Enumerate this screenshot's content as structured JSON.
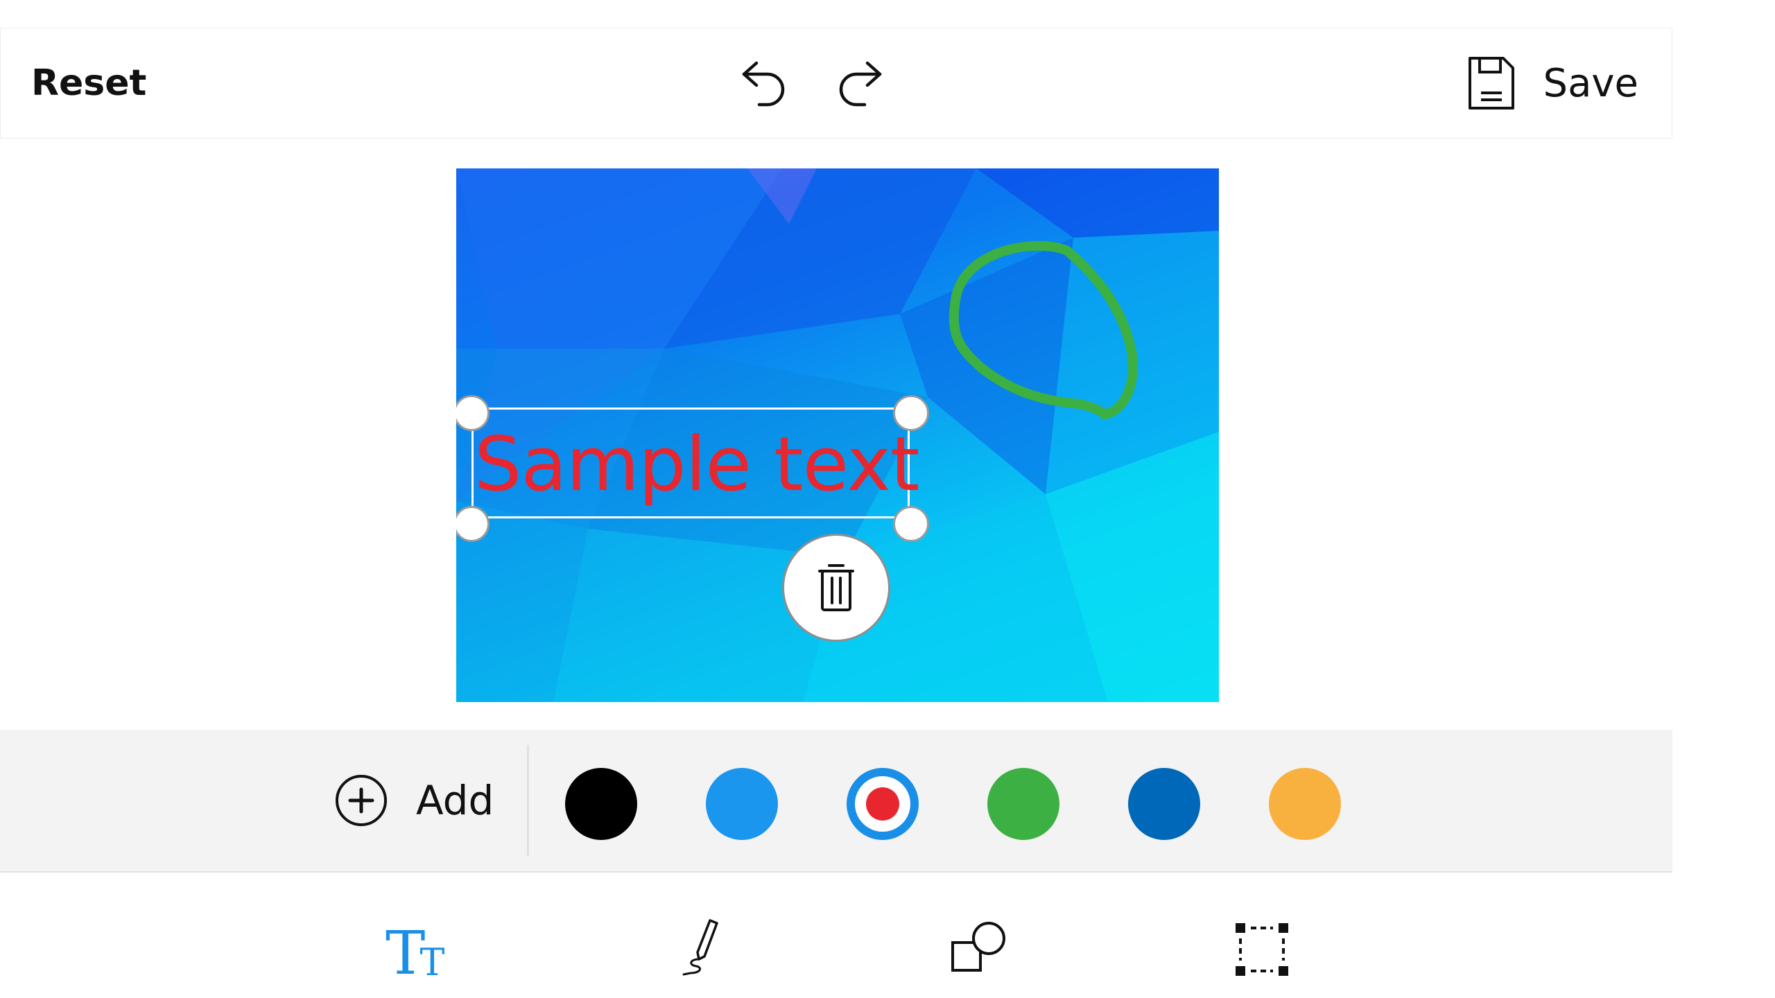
{
  "toolbar": {
    "reset_label": "Reset",
    "undo_icon": "undo-icon",
    "redo_icon": "redo-icon",
    "save_icon": "save-icon",
    "save_label": "Save"
  },
  "canvas": {
    "annotation_text": "Sample text",
    "annotation_text_color": "#e8262f",
    "drawing_color": "#3cb043",
    "delete_icon": "trash-icon"
  },
  "colors": {
    "add_icon": "plus-circle-icon",
    "add_label": "Add",
    "swatches": [
      {
        "name": "black",
        "hex": "#000000",
        "selected": false
      },
      {
        "name": "light-blue",
        "hex": "#1a96ee",
        "selected": false
      },
      {
        "name": "red",
        "hex": "#e8262f",
        "selected": true
      },
      {
        "name": "green",
        "hex": "#3cb043",
        "selected": false
      },
      {
        "name": "dark-blue",
        "hex": "#0068b8",
        "selected": false
      },
      {
        "name": "orange",
        "hex": "#f8b03e",
        "selected": false
      }
    ]
  },
  "tools": [
    {
      "name": "text-tool",
      "icon": "text-size-icon",
      "active": true,
      "accent": "#1a8fe8"
    },
    {
      "name": "pen-tool",
      "icon": "pen-icon",
      "active": false
    },
    {
      "name": "shape-tool",
      "icon": "shapes-icon",
      "active": false
    },
    {
      "name": "crop-tool",
      "icon": "crop-select-icon",
      "active": false
    }
  ],
  "tool_glyphs": {
    "text_big": "T",
    "text_small": "T"
  }
}
